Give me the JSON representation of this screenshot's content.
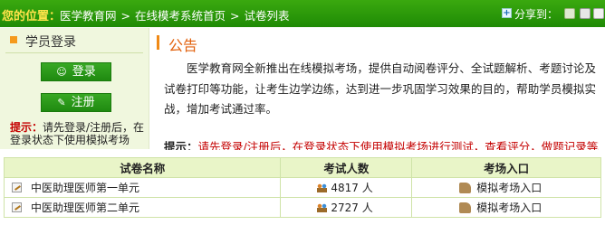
{
  "header": {
    "location_label": "您的位置：",
    "breadcrumbs": [
      "医学教育网",
      "在线模考系统首页",
      "试卷列表"
    ],
    "separator": ">",
    "share_label": "分享到："
  },
  "login_panel": {
    "title": "学员登录",
    "login_button": "登录",
    "register_button": "注册",
    "tip_label": "提示：",
    "tip_text": "请先登录/注册后，在登录状态下使用模拟考场"
  },
  "notice": {
    "title": "公告",
    "body": "医学教育网全新推出在线模拟考场，提供自动阅卷评分、全试题解析、考题讨论及试卷打印等功能，让考生边学边练，达到进一步巩固学习效果的目的，帮助学员模拟实战，增加考试通过率。",
    "tip_label": "提示：",
    "tip_login": "请先登录",
    "tip_slash": "/",
    "tip_register": "注册",
    "tip_rest": "后，在登录状态下使用模拟考场进行测试，查看评分，做题记录等功"
  },
  "exam_table": {
    "headers": [
      "试卷名称",
      "考试人数",
      "考场入口"
    ],
    "rows": [
      {
        "name": "中医助理医师第一单元",
        "count": "4817 人",
        "entry": "模拟考场入口"
      },
      {
        "name": "中医助理医师第二单元",
        "count": "2727 人",
        "entry": "模拟考场入口"
      }
    ]
  },
  "colors": {
    "header_green": "#2a9a0a",
    "location_yellow": "#ffe34a",
    "notice_orange": "#e2610d",
    "tip_red": "#c40000",
    "panel_bg": "#f0f7de"
  }
}
